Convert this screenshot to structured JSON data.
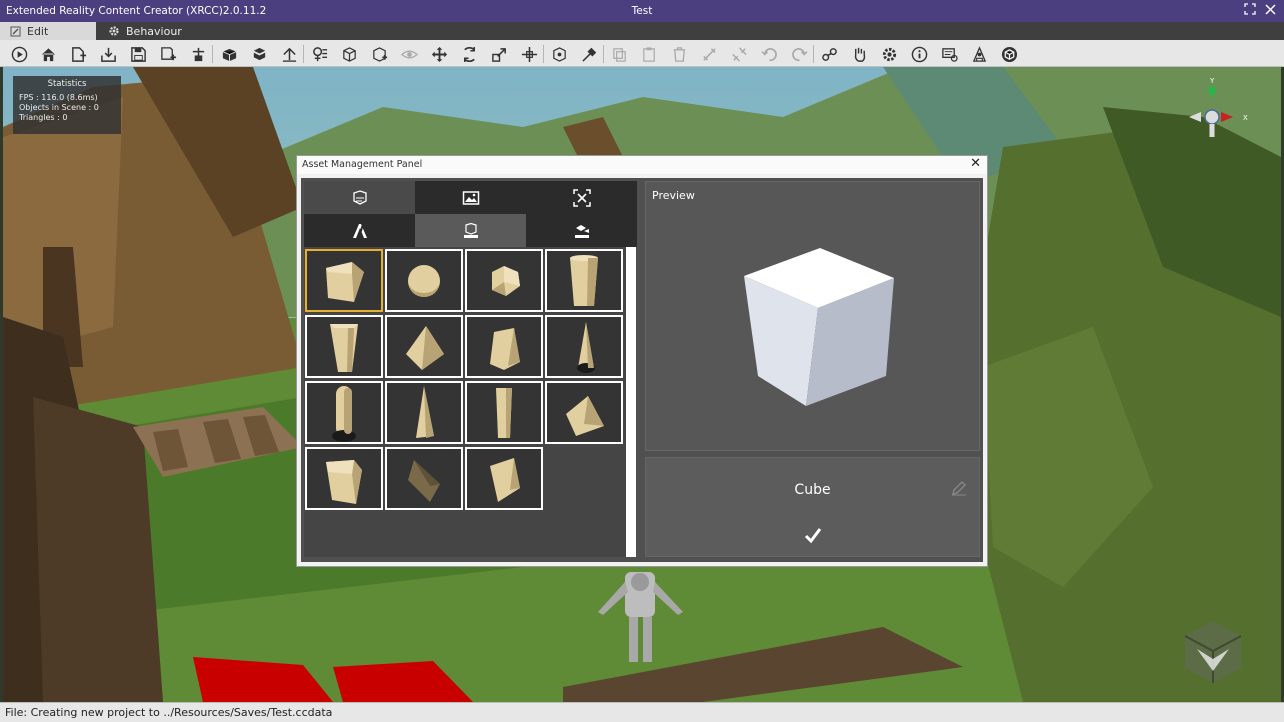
{
  "window": {
    "app_title": "Extended Reality Content Creator (XRCC)2.0.11.2",
    "document_title": "Test"
  },
  "modes": [
    {
      "label": "Edit",
      "icon": "edit-icon",
      "active": true
    },
    {
      "label": "Behaviour",
      "icon": "gear-icon",
      "active": false
    }
  ],
  "toolbar": {
    "buttons": [
      "play",
      "home",
      "add-scene",
      "import",
      "save",
      "save-as",
      "export",
      "model",
      "package",
      "upload",
      "script",
      "object",
      "add-object",
      "visibility",
      "move",
      "rotate",
      "scale",
      "transform",
      "pivot",
      "pick",
      "copy",
      "paste",
      "delete",
      "link",
      "unlink",
      "undo",
      "redo",
      "nodes",
      "hand",
      "settings",
      "info",
      "presentation",
      "character",
      "unity"
    ]
  },
  "stats": {
    "title": "Statistics",
    "fps": "FPS : 116.0 (8.6ms)",
    "objects": "Objects in Scene : 0",
    "triangles": "Triangles : 0"
  },
  "gizmo": {
    "y_label": "Y",
    "x_label": "X"
  },
  "panel": {
    "title": "Asset Management Panel",
    "tabs": [
      {
        "icon": "models-tab-icon",
        "active": false
      },
      {
        "icon": "image-tab-icon",
        "active": false
      },
      {
        "icon": "ar-tab-icon",
        "active": false
      },
      {
        "icon": "text-tab-icon",
        "active": false
      },
      {
        "icon": "generic-tab-icon",
        "active": true
      },
      {
        "icon": "default-tab-icon",
        "active": false
      }
    ],
    "assets": [
      "Cube",
      "Sphere",
      "Polyhedron",
      "Cylinder",
      "Tall Prism",
      "Pyramid",
      "Truncated Pyramid",
      "Cone",
      "Capsule",
      "Tall Pyramid",
      "Narrow Prism",
      "Wedge",
      "Box Wedge",
      "Tilted Cube",
      "Skewed Block"
    ],
    "selected": "Cube",
    "preview_label": "Preview",
    "selected_name": "Cube",
    "confirm_icon": "check-icon"
  },
  "status": {
    "message": "File: Creating new project to ../Resources/Saves/Test.ccdata"
  },
  "colors": {
    "titlebar": "#4c3f80",
    "toolbar": "#e7e7e7",
    "selection": "#e8b030",
    "asset_fill": "#e2cfa0"
  }
}
